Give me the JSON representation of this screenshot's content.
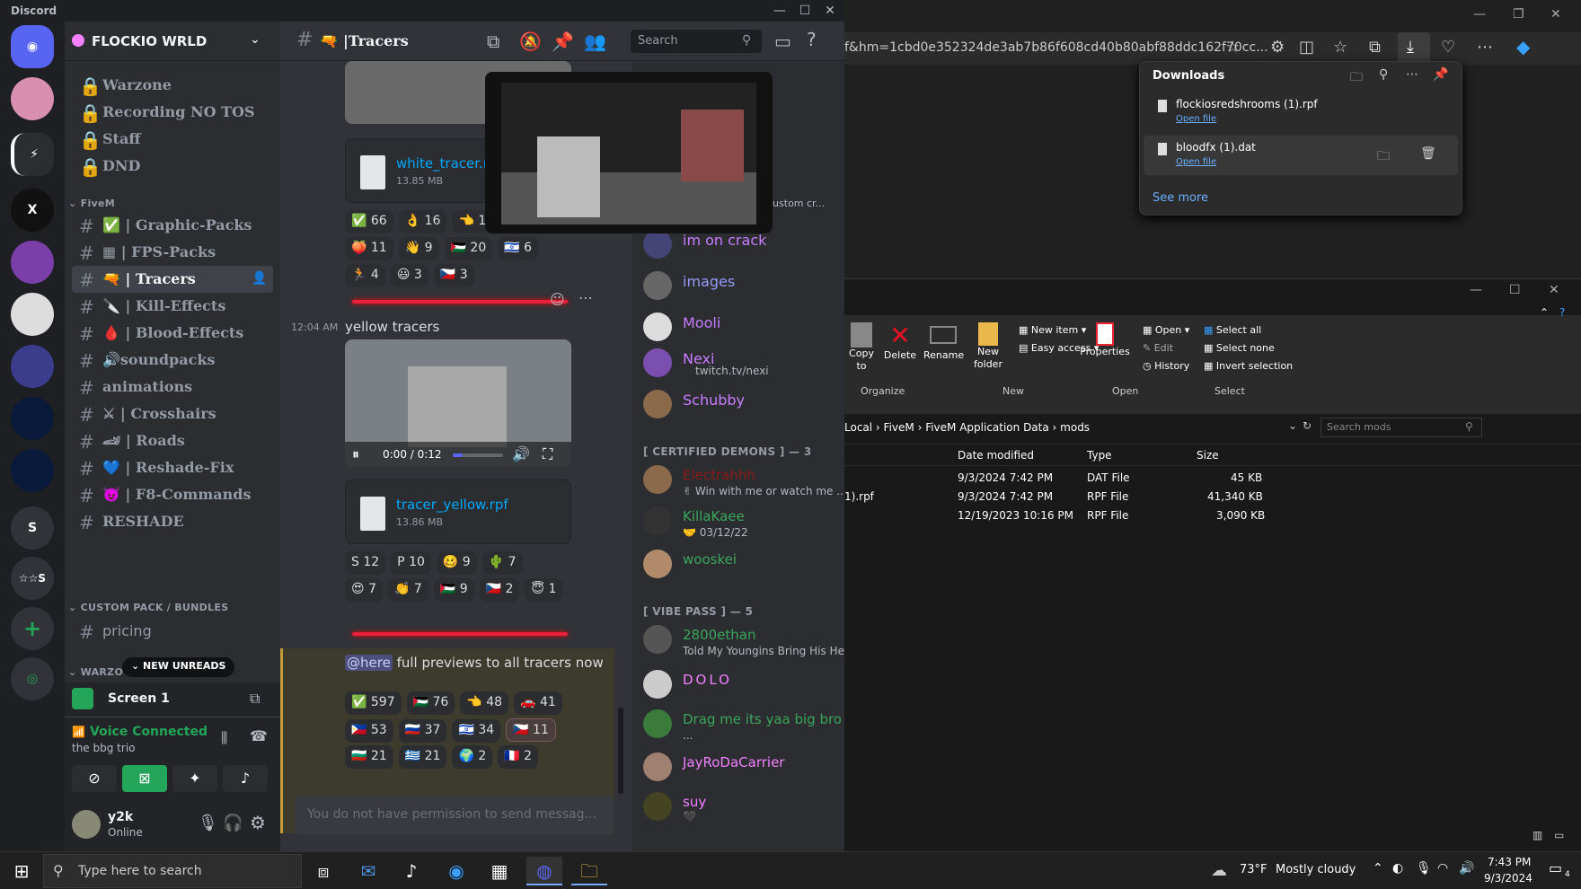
{
  "discord": {
    "app_title": "Discord",
    "server_name": "FLOCKIO WRLD",
    "servers": [
      "",
      "",
      "",
      "",
      "",
      "",
      "",
      "",
      "",
      "S",
      "☆☆S",
      "+",
      ""
    ],
    "channels_top": [
      {
        "label": "Warzone",
        "icon": "lock-speaker"
      },
      {
        "label": "Recording NO TOS",
        "icon": "lock-speaker"
      },
      {
        "label": "Staff",
        "icon": "lock-speaker"
      },
      {
        "label": "DND",
        "icon": "lock-emoji"
      }
    ],
    "category_fivem": "FiveM",
    "channels": [
      {
        "label": "Graphic-Packs",
        "emoji": "✅"
      },
      {
        "label": "FPS-Packs",
        "emoji": "▦"
      },
      {
        "label": "Tracers",
        "emoji": "🔫"
      },
      {
        "label": "Kill-Effects",
        "emoji": "🔪"
      },
      {
        "label": "Blood-Effects",
        "emoji": "🩸"
      },
      {
        "label": "soundpacks",
        "emoji": "🔊"
      },
      {
        "label": "animations",
        "emoji": ""
      },
      {
        "label": "Crosshairs",
        "emoji": "⚔"
      },
      {
        "label": "Roads",
        "emoji": "🏎"
      },
      {
        "label": "Reshade-Fix",
        "emoji": "💙"
      },
      {
        "label": "F8-Commands",
        "emoji": "😈"
      },
      {
        "label": "RESHADE",
        "emoji": ""
      }
    ],
    "category_custom": "CUSTOM PACK / BUNDLES",
    "channel_pricing": "pricing",
    "category_warzone": "WARZO",
    "new_unreads": "NEW UNREADS",
    "screen_label": "Screen 1",
    "voice_status": "Voice Connected",
    "voice_channel": "the bbg trio",
    "user_name": "y2k",
    "user_status": "Online",
    "channel_title": "Tracers",
    "search_placeholder": "Search",
    "messages": {
      "file1_name": "white_tracer.rpf",
      "file1_size": "13.85 MB",
      "reactions1": [
        [
          "✅",
          "66"
        ],
        [
          "👌",
          "16"
        ],
        [
          "👈",
          "1"
        ]
      ],
      "reactions2": [
        [
          "🍑",
          "11"
        ],
        [
          "👋",
          "9"
        ],
        [
          "🇵🇸",
          "20"
        ],
        [
          "🇮🇱",
          "6"
        ]
      ],
      "reactions3": [
        [
          "🏃",
          "4"
        ],
        [
          "😃",
          "3"
        ],
        [
          "🇨🇿",
          "3"
        ]
      ],
      "timestamp": "12:04 AM",
      "text_yellow": "yellow tracers",
      "video_time": "0:00 / 0:12",
      "file2_name": "tracer_yellow.rpf",
      "file2_size": "13.86 MB",
      "reactions4": [
        [
          "S",
          "12"
        ],
        [
          "P",
          "10"
        ],
        [
          "🥴",
          "9"
        ],
        [
          "🌵",
          "7"
        ]
      ],
      "reactions5": [
        [
          "😍",
          "7"
        ],
        [
          "👏",
          "7"
        ],
        [
          "🇵🇸",
          "9"
        ],
        [
          "🇨🇿",
          "2"
        ],
        [
          "😇",
          "1"
        ]
      ],
      "mention": "@here",
      "text_here": " full previews to all tracers now",
      "reactions6": [
        [
          "✅",
          "597"
        ],
        [
          "🇵🇸",
          "76"
        ],
        [
          "👈",
          "48"
        ],
        [
          "🚗",
          "41"
        ]
      ],
      "reactions7": [
        [
          "🇵🇭",
          "53"
        ],
        [
          "🇷🇺",
          "37"
        ],
        [
          "🇮🇱",
          "34"
        ],
        [
          "🇨🇿",
          "11"
        ]
      ],
      "reactions8": [
        [
          "🇧🇬",
          "21"
        ],
        [
          "🇬🇷",
          "21"
        ],
        [
          "🌍",
          "2"
        ],
        [
          "🇫🇷",
          "2"
        ]
      ],
      "input_placeholder": "You do not have permission to send messag..."
    },
    "members": {
      "popup_status": "custom cr...",
      "items1": [
        {
          "name": "im on crack",
          "status": "",
          "color": "#c77dff"
        },
        {
          "name": "images",
          "status": "",
          "color": "#5865f2"
        },
        {
          "name": "Mooli",
          "status": "",
          "color": "#c77dff"
        },
        {
          "name": "Nexi",
          "status": "twitch.tv/nexi",
          "color": "#c77dff"
        },
        {
          "name": "Schubby",
          "status": "",
          "color": "#c77dff"
        }
      ],
      "group2": "[ CERTIFIED DEMONS ] — 3",
      "items2": [
        {
          "name": "Electrahhh",
          "status": "✌ Win with me or watch me ...",
          "color": "#8b1a1a"
        },
        {
          "name": "KillaKaee",
          "status": "🤝 03/12/22",
          "color": "#3ba55c"
        },
        {
          "name": "wooskei",
          "status": "",
          "color": "#3ba55c"
        }
      ],
      "group3": "[ VIBE PASS ] — 5",
      "items3": [
        {
          "name": "2800ethan",
          "status": "Told My Youngins Bring His He...",
          "color": "#3ba55c"
        },
        {
          "name": "DOLO",
          "status": "",
          "color": "#f47fff"
        },
        {
          "name": "Drag me its yaa big bro",
          "status": "...",
          "color": "#3ba55c"
        },
        {
          "name": "JayRoDaCarrier",
          "status": "",
          "color": "#f47fff"
        },
        {
          "name": "suy",
          "status": "🖤",
          "color": "#f47fff"
        }
      ]
    }
  },
  "browser": {
    "address": "f&hm=1cbd0e352324de3ab7b86f608cd40b80abf88ddc162f70cc...",
    "downloads_title": "Downloads",
    "items": [
      {
        "name": "flockiosredshrooms (1).rpf",
        "action": "Open file"
      },
      {
        "name": "bloodfx (1).dat",
        "action": "Open file"
      }
    ],
    "see_more": "See more"
  },
  "explorer": {
    "ribbon": {
      "copy_to": "Copy to",
      "delete": "Delete",
      "rename": "Rename",
      "new_folder": "New folder",
      "new_item": "New item",
      "easy_access": "Easy access",
      "properties": "Properties",
      "open": "Open",
      "edit": "Edit",
      "history": "History",
      "select_all": "Select all",
      "select_none": "Select none",
      "invert_selection": "Invert selection",
      "group_organize": "Organize",
      "group_new": "New",
      "group_open": "Open",
      "group_select": "Select"
    },
    "path": [
      "Local",
      "FiveM",
      "FiveM Application Data",
      "mods"
    ],
    "search_placeholder": "Search mods",
    "columns": [
      "Date modified",
      "Type",
      "Size"
    ],
    "rows": [
      {
        "name": "",
        "date": "9/3/2024 7:42 PM",
        "type": "DAT File",
        "size": "45 KB"
      },
      {
        "name": "1).rpf",
        "date": "9/3/2024 7:42 PM",
        "type": "RPF File",
        "size": "41,340 KB"
      },
      {
        "name": "",
        "date": "12/19/2023 10:16 PM",
        "type": "RPF File",
        "size": "3,090 KB"
      }
    ]
  },
  "taskbar": {
    "search_placeholder": "Type here to search",
    "weather_temp": "73°F",
    "weather_desc": "Mostly cloudy",
    "time": "7:43 PM",
    "date": "9/3/2024",
    "notif_count": "4"
  }
}
